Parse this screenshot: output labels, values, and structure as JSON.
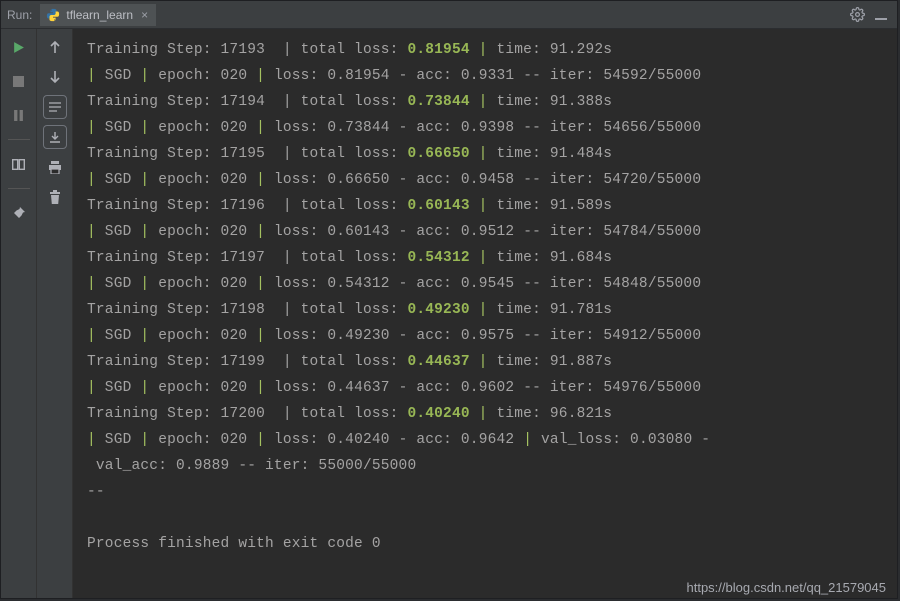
{
  "topbar": {
    "run_label": "Run:",
    "tab_name": "tflearn_learn"
  },
  "console": {
    "steps": [
      {
        "step": "17193",
        "total_loss": "0.81954",
        "time": "91.292s",
        "epoch": "020",
        "loss": "0.81954",
        "acc": "0.9331",
        "iter": "54592/55000"
      },
      {
        "step": "17194",
        "total_loss": "0.73844",
        "time": "91.388s",
        "epoch": "020",
        "loss": "0.73844",
        "acc": "0.9398",
        "iter": "54656/55000"
      },
      {
        "step": "17195",
        "total_loss": "0.66650",
        "time": "91.484s",
        "epoch": "020",
        "loss": "0.66650",
        "acc": "0.9458",
        "iter": "54720/55000"
      },
      {
        "step": "17196",
        "total_loss": "0.60143",
        "time": "91.589s",
        "epoch": "020",
        "loss": "0.60143",
        "acc": "0.9512",
        "iter": "54784/55000"
      },
      {
        "step": "17197",
        "total_loss": "0.54312",
        "time": "91.684s",
        "epoch": "020",
        "loss": "0.54312",
        "acc": "0.9545",
        "iter": "54848/55000"
      },
      {
        "step": "17198",
        "total_loss": "0.49230",
        "time": "91.781s",
        "epoch": "020",
        "loss": "0.49230",
        "acc": "0.9575",
        "iter": "54912/55000"
      },
      {
        "step": "17199",
        "total_loss": "0.44637",
        "time": "91.887s",
        "epoch": "020",
        "loss": "0.44637",
        "acc": "0.9602",
        "iter": "54976/55000"
      }
    ],
    "final": {
      "step": "17200",
      "total_loss": "0.40240",
      "time": "96.821s",
      "epoch": "020",
      "loss": "0.40240",
      "acc": "0.9642",
      "val_loss": "0.03080",
      "val_acc": "0.9889",
      "iter": "55000/55000"
    },
    "tail_sep": "--",
    "exit_line": "Process finished with exit code 0"
  },
  "watermark": "https://blog.csdn.net/qq_21579045"
}
